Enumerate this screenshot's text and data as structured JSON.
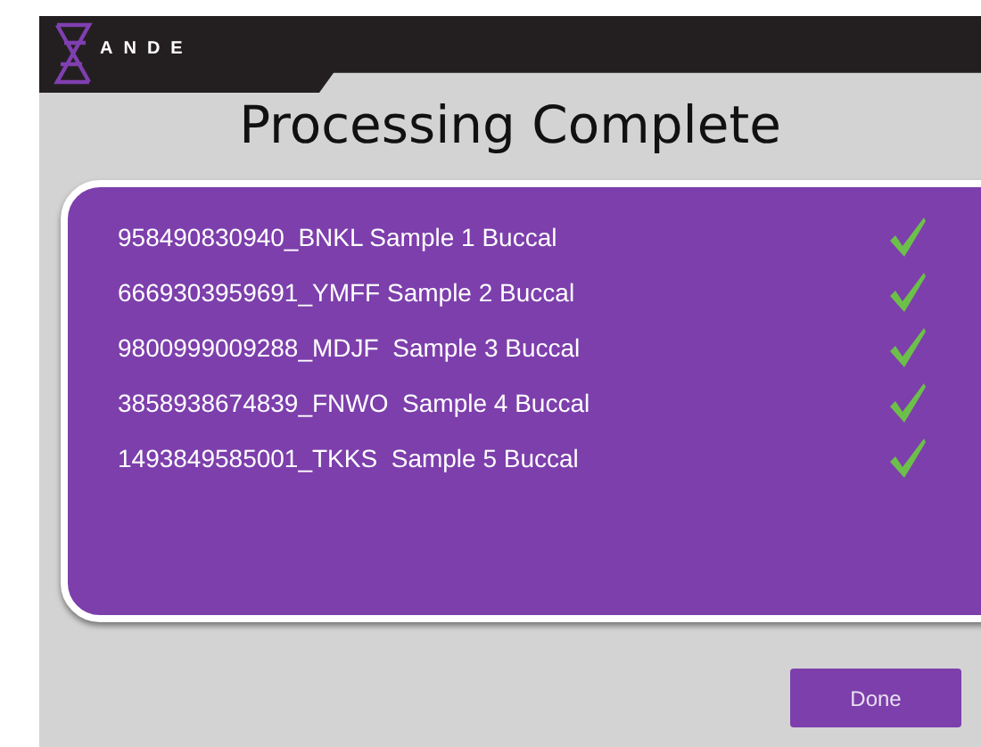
{
  "header": {
    "logo": "ANDE"
  },
  "title": "Processing Complete",
  "samples": [
    {
      "label": "958490830940_BNKL Sample 1 Buccal",
      "complete": true
    },
    {
      "label": "6669303959691_YMFF Sample 2 Buccal",
      "complete": true
    },
    {
      "label": "9800999009288_MDJF  Sample 3 Buccal",
      "complete": true
    },
    {
      "label": "3858938674839_FNWO  Sample 4 Buccal",
      "complete": true
    },
    {
      "label": "1493849585001_TKKS  Sample 5 Buccal",
      "complete": true
    }
  ],
  "buttons": [
    "Done"
  ]
}
